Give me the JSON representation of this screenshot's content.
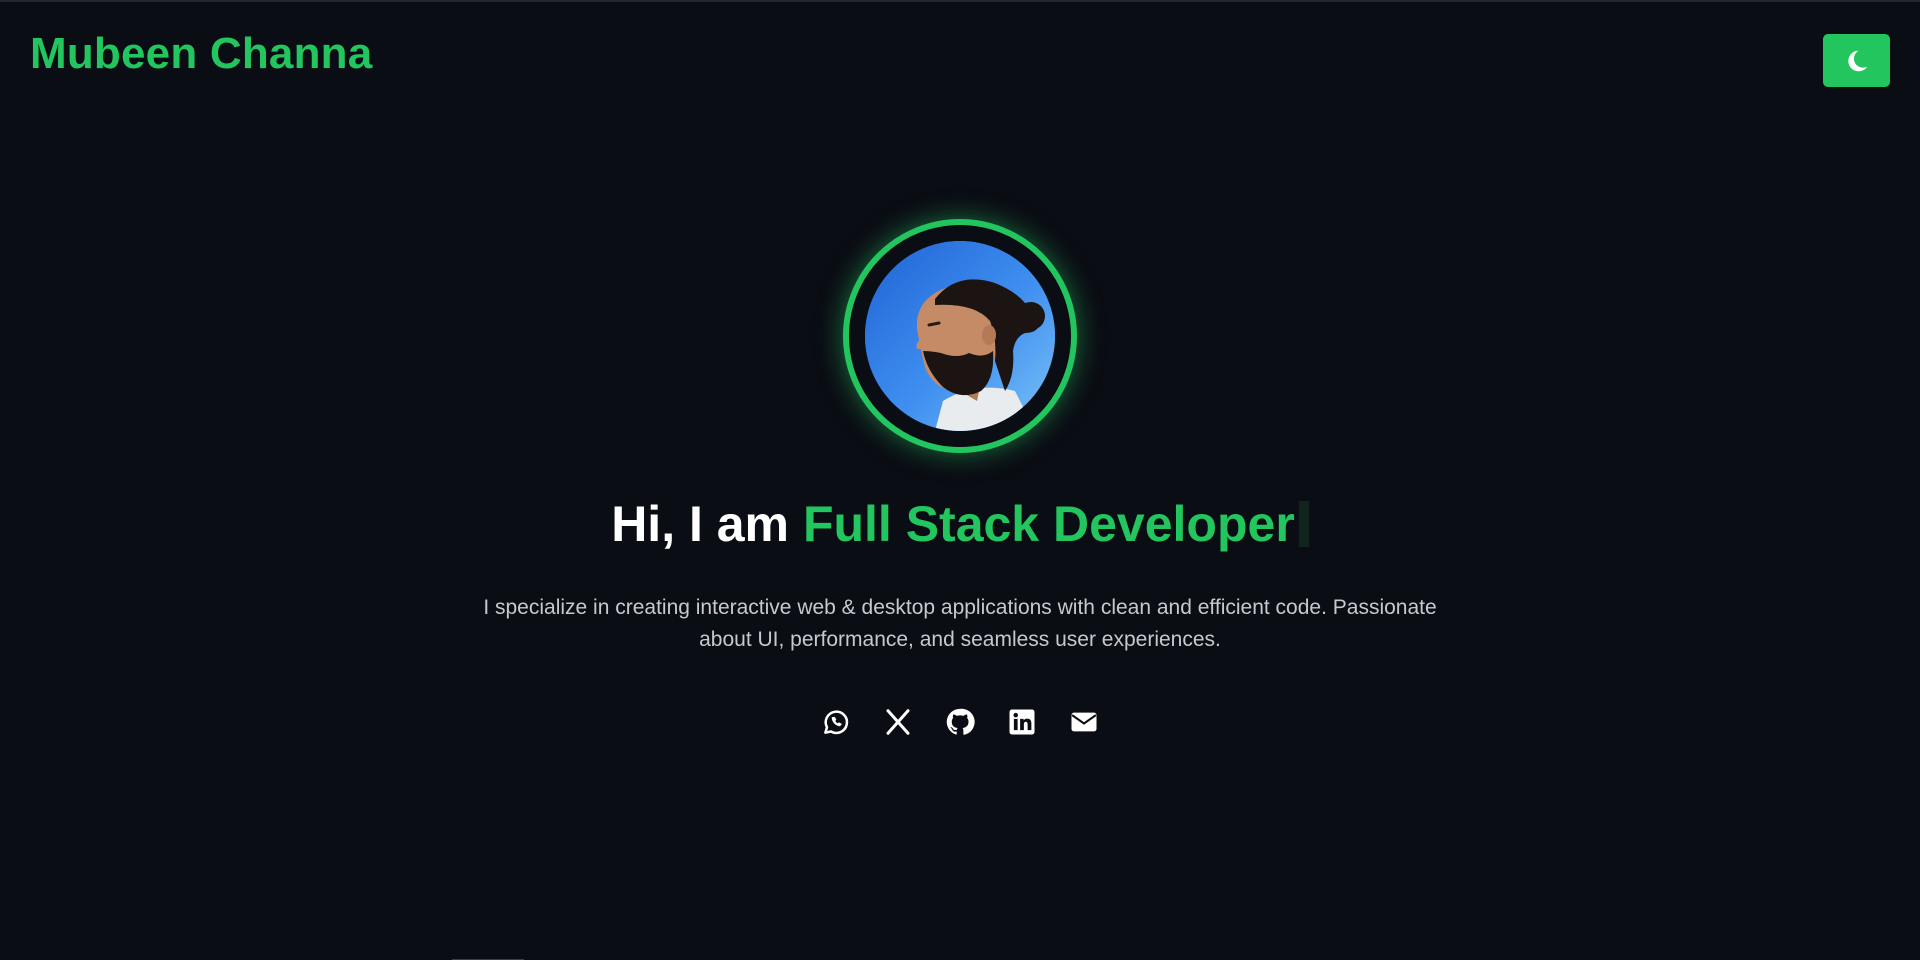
{
  "header": {
    "brand": "Mubeen Channa",
    "theme_toggle_icon": "moon-icon"
  },
  "hero": {
    "avatar_alt": "Mubeen Channa profile photo",
    "greeting": "Hi, I am",
    "role": "Full Stack Developer",
    "bio": "I specialize in creating interactive web & desktop applications with clean and efficient code. Passionate about UI, performance, and seamless user experiences.",
    "socials": [
      {
        "name": "whatsapp",
        "icon": "whatsapp-icon"
      },
      {
        "name": "x",
        "icon": "x-icon"
      },
      {
        "name": "github",
        "icon": "github-icon"
      },
      {
        "name": "linkedin",
        "icon": "linkedin-icon"
      },
      {
        "name": "email",
        "icon": "envelope-icon"
      }
    ]
  },
  "colors": {
    "background": "#0b0d14",
    "accent": "#22c55e",
    "text": "#ffffff",
    "muted_text": "#c7c9cf"
  }
}
